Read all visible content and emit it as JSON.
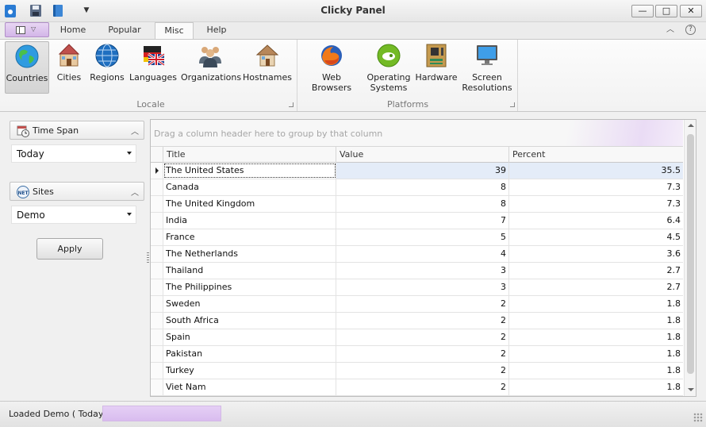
{
  "window": {
    "title": "Clicky Panel",
    "minimize_glyph": "—",
    "maximize_glyph": "□",
    "close_glyph": "✕"
  },
  "quick_access": {
    "icons": [
      "app-icon",
      "save-icon",
      "book-icon",
      "quick-access-dropdown-icon"
    ]
  },
  "tabs": [
    {
      "label": "Home"
    },
    {
      "label": "Popular"
    },
    {
      "label": "Misc",
      "active": true
    },
    {
      "label": "Help"
    }
  ],
  "ribbon": {
    "groups": [
      {
        "label": "Locale",
        "buttons": [
          {
            "label": "Countries",
            "icon": "globe-icon",
            "active": true
          },
          {
            "label": "Cities",
            "icon": "city-icon"
          },
          {
            "label": "Regions",
            "icon": "regions-globe-icon"
          },
          {
            "label": "Languages",
            "icon": "flags-icon"
          },
          {
            "label": "Organizations",
            "icon": "people-group-icon"
          },
          {
            "label": "Hostnames",
            "icon": "house-icon"
          }
        ]
      },
      {
        "label": "Platforms",
        "buttons": [
          {
            "label": "Web Browsers",
            "icon": "firefox-icon"
          },
          {
            "label": "Operating Systems",
            "label_lines": [
              "Operating",
              "Systems"
            ],
            "icon": "opensuse-icon"
          },
          {
            "label": "Hardware",
            "icon": "circuit-board-icon"
          },
          {
            "label": "Screen Resolutions",
            "label_lines": [
              "Screen",
              "Resolutions"
            ],
            "icon": "monitor-icon"
          }
        ]
      }
    ]
  },
  "sidebar": {
    "time_span": {
      "title": "Time Span",
      "value": "Today",
      "icon": "clock-calendar-icon"
    },
    "sites": {
      "title": "Sites",
      "value": "Demo",
      "icon": "net-icon",
      "icon_text": "NET"
    },
    "apply_label": "Apply"
  },
  "grid": {
    "group_hint": "Drag a column header here to group by that column",
    "columns": [
      "Title",
      "Value",
      "Percent"
    ],
    "rows": [
      {
        "title": "The United States",
        "value": "39",
        "percent": "35.5"
      },
      {
        "title": "Canada",
        "value": "8",
        "percent": "7.3"
      },
      {
        "title": "The United Kingdom",
        "value": "8",
        "percent": "7.3"
      },
      {
        "title": "India",
        "value": "7",
        "percent": "6.4"
      },
      {
        "title": "France",
        "value": "5",
        "percent": "4.5"
      },
      {
        "title": "The Netherlands",
        "value": "4",
        "percent": "3.6"
      },
      {
        "title": "Thailand",
        "value": "3",
        "percent": "2.7"
      },
      {
        "title": "The Philippines",
        "value": "3",
        "percent": "2.7"
      },
      {
        "title": "Sweden",
        "value": "2",
        "percent": "1.8"
      },
      {
        "title": "South Africa",
        "value": "2",
        "percent": "1.8"
      },
      {
        "title": "Spain",
        "value": "2",
        "percent": "1.8"
      },
      {
        "title": "Pakistan",
        "value": "2",
        "percent": "1.8"
      },
      {
        "title": "Turkey",
        "value": "2",
        "percent": "1.8"
      },
      {
        "title": "Viet Nam",
        "value": "2",
        "percent": "1.8"
      }
    ],
    "selected_row": 0
  },
  "status": {
    "text": "Loaded Demo ( Today )",
    "progress_fraction": 1.0
  },
  "colors": {
    "accent_purple": "#d9bcef",
    "selection": "#e4ecf8"
  }
}
